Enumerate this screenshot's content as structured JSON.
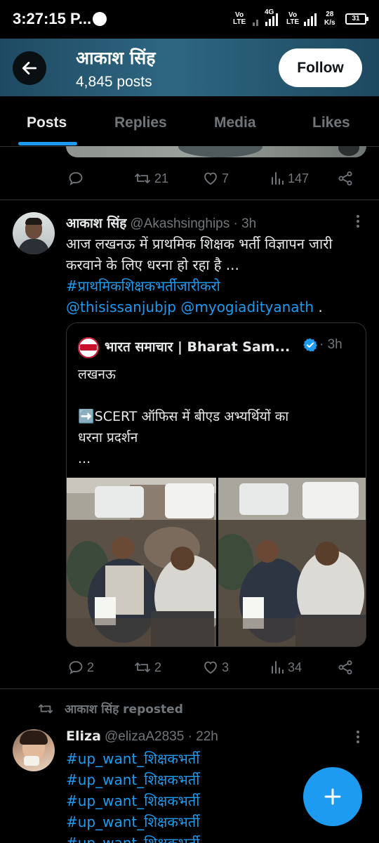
{
  "status_bar": {
    "time": "3:27:15 P...",
    "net1_top": "Vo",
    "net1_bottom": "LTE",
    "net2_top": "4G",
    "net3_top": "Vo",
    "net3_bottom": "LTE",
    "speed_value": "28",
    "speed_unit": "K/s",
    "battery": "31"
  },
  "header": {
    "name": "आकाश सिंह",
    "posts_count": "4,845 posts",
    "follow_label": "Follow"
  },
  "tabs": [
    {
      "label": "Posts",
      "active": true
    },
    {
      "label": "Replies",
      "active": false
    },
    {
      "label": "Media",
      "active": false
    },
    {
      "label": "Likes",
      "active": false
    }
  ],
  "prev_tweet_actions": {
    "reply": "",
    "repost": "21",
    "like": "7",
    "views": "147"
  },
  "tweet": {
    "name": "आकाश सिंह",
    "handle_time": "@Akashsinghips · 3h",
    "text_line1": "आज लखनऊ में प्राथमिक शिक्षक भर्ती विज्ञापन जारी",
    "text_line2": "करवाने के लिए  धरना हो रहा है ...",
    "hashtag": "#प्राथमिकशिक्षकभर्तीजारीकरो",
    "mention1": "@thisissanjubjp",
    "mention2": "@myogiadityanath",
    "trailing": " .",
    "quote": {
      "name": "भारत समाचार | Bharat Sam...",
      "time": "· 3h",
      "line1": "लखनऊ",
      "line2": "➡️SCERT ऑफिस में बीएड अभ्यर्थियों का",
      "line3": "धरना प्रदर्शन",
      "line4": "..."
    },
    "actions": {
      "reply": "2",
      "repost": "2",
      "like": "3",
      "views": "34"
    }
  },
  "repost": {
    "label": "आकाश सिंह reposted",
    "name": "Eliza",
    "handle_time": "@elizaA2835 · 22h",
    "lines": [
      "#up_want_शिक्षकभर्ती",
      "#up_want_शिक्षकभर्ती",
      "#up_want_शिक्षकभर्ती",
      "#up_want_शिक्षकभर्ती",
      "#up_want_शिक्षकभर्ती"
    ]
  },
  "colors": {
    "accent": "#1d9bf0",
    "muted": "#71767b",
    "text": "#e7e9ea",
    "verified": "#1d9bf0"
  },
  "icons": [
    "arrow-left-icon",
    "reply-icon",
    "repost-icon",
    "heart-icon",
    "views-icon",
    "share-icon",
    "more-icon",
    "verified-icon",
    "plus-icon"
  ]
}
